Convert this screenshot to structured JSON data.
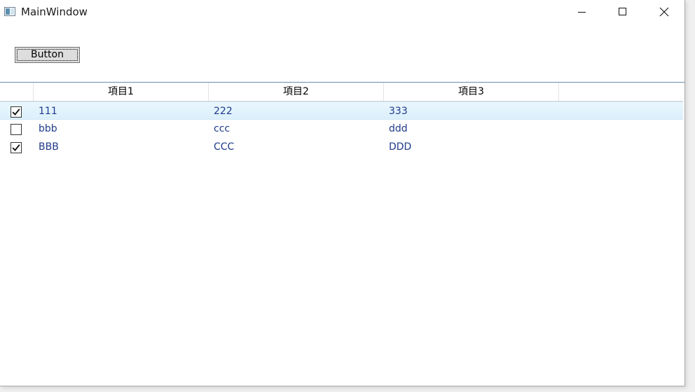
{
  "window": {
    "title": "MainWindow",
    "icon": "app-window-icon",
    "controls": [
      "minimize-icon",
      "maximize-icon",
      "close-icon"
    ]
  },
  "button": {
    "label": "Button"
  },
  "grid": {
    "columns": [
      "項目1",
      "項目2",
      "項目3"
    ],
    "rows": [
      {
        "checked": true,
        "selected": true,
        "cells": [
          "111",
          "222",
          "333"
        ]
      },
      {
        "checked": false,
        "selected": false,
        "cells": [
          "bbb",
          "ccc",
          "ddd"
        ]
      },
      {
        "checked": true,
        "selected": false,
        "cells": [
          "BBB",
          "CCC",
          "DDD"
        ]
      }
    ]
  },
  "colors": {
    "cell_text": "#1e3a8a",
    "selected_row": "#dbf0fc",
    "grid_border": "#688caf"
  }
}
